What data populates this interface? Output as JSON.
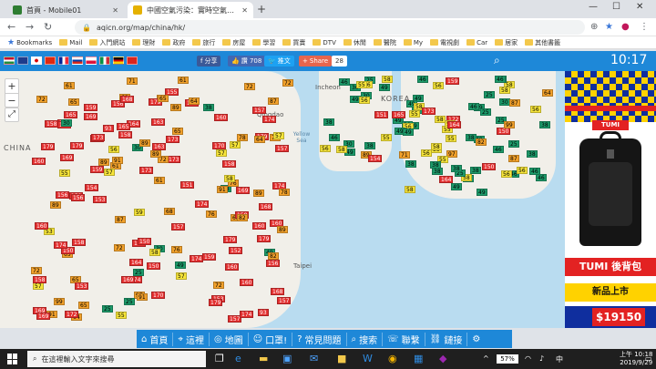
{
  "tabs": [
    {
      "title": "首頁 - Mobile01",
      "favicon_color": "#2e7d32"
    },
    {
      "title": "中國空氣污染：實時空氣質量指數",
      "favicon_color": "#e5b100"
    }
  ],
  "address": {
    "url": "aqicn.org/map/china/hk/"
  },
  "bookmarks": [
    {
      "label": "Bookmarks"
    },
    {
      "label": "Mail"
    },
    {
      "label": "入門網站"
    },
    {
      "label": "理財"
    },
    {
      "label": "政府"
    },
    {
      "label": "旅行"
    },
    {
      "label": "房屋"
    },
    {
      "label": "學習"
    },
    {
      "label": "買賣"
    },
    {
      "label": "DTV"
    },
    {
      "label": "休閒"
    },
    {
      "label": "醫院"
    },
    {
      "label": "My"
    },
    {
      "label": "電視劇"
    },
    {
      "label": "Car"
    },
    {
      "label": "居家"
    },
    {
      "label": "其他書籤"
    }
  ],
  "share": {
    "fb_label": "分享",
    "like_label": "讚 708",
    "tweet_label": "推文",
    "share_label": "Share",
    "share_count": "28"
  },
  "clock": "10:17",
  "map": {
    "label_china": "CHINA",
    "label_korea": "KOREA",
    "label_incheon": "Incheon",
    "label_qingdao": "Qingdao",
    "label_yellow_sea": "Yellow Sea",
    "label_taipei": "Taipei",
    "colors": {
      "hazard": "#e32f2f",
      "unhealthy": "#f2a12b",
      "moderate": "#f7e53a",
      "good": "#1d9a6a"
    },
    "stations": [
      {
        "v": "93",
        "c": "hazard"
      },
      {
        "v": "72",
        "c": "unhealthy"
      },
      {
        "v": "163",
        "c": "hazard"
      },
      {
        "v": "172",
        "c": "hazard"
      },
      {
        "v": "154",
        "c": "hazard"
      },
      {
        "v": "157",
        "c": "hazard"
      },
      {
        "v": "160",
        "c": "hazard"
      },
      {
        "v": "173",
        "c": "hazard"
      },
      {
        "v": "174",
        "c": "hazard"
      },
      {
        "v": "71",
        "c": "unhealthy"
      },
      {
        "v": "61",
        "c": "unhealthy"
      },
      {
        "v": "89",
        "c": "unhealthy"
      },
      {
        "v": "159",
        "c": "hazard"
      },
      {
        "v": "152",
        "c": "hazard"
      },
      {
        "v": "158",
        "c": "hazard"
      },
      {
        "v": "165",
        "c": "hazard"
      },
      {
        "v": "87",
        "c": "unhealthy"
      },
      {
        "v": "53",
        "c": "moderate"
      },
      {
        "v": "151",
        "c": "hazard"
      },
      {
        "v": "156",
        "c": "hazard"
      },
      {
        "v": "168",
        "c": "hazard"
      },
      {
        "v": "64",
        "c": "unhealthy"
      },
      {
        "v": "155",
        "c": "hazard"
      },
      {
        "v": "179",
        "c": "hazard"
      },
      {
        "v": "169",
        "c": "hazard"
      },
      {
        "v": "153",
        "c": "hazard"
      },
      {
        "v": "91",
        "c": "unhealthy"
      },
      {
        "v": "97",
        "c": "unhealthy"
      },
      {
        "v": "65",
        "c": "unhealthy"
      },
      {
        "v": "56",
        "c": "moderate"
      },
      {
        "v": "49",
        "c": "good"
      },
      {
        "v": "164",
        "c": "hazard"
      },
      {
        "v": "59",
        "c": "moderate"
      },
      {
        "v": "76",
        "c": "unhealthy"
      },
      {
        "v": "70",
        "c": "unhealthy"
      },
      {
        "v": "38",
        "c": "good"
      },
      {
        "v": "25",
        "c": "good"
      },
      {
        "v": "30",
        "c": "good"
      },
      {
        "v": "58",
        "c": "moderate"
      },
      {
        "v": "55",
        "c": "moderate"
      },
      {
        "v": "46",
        "c": "good"
      },
      {
        "v": "99",
        "c": "unhealthy"
      },
      {
        "v": "68",
        "c": "unhealthy"
      },
      {
        "v": "57",
        "c": "moderate"
      },
      {
        "v": "82",
        "c": "unhealthy"
      },
      {
        "v": "78",
        "c": "unhealthy"
      },
      {
        "v": "150",
        "c": "hazard"
      },
      {
        "v": "170",
        "c": "hazard"
      }
    ]
  },
  "ad": {
    "title": "TUMI 後背包",
    "subtitle": "新品上市",
    "price": "$19150",
    "logo": "TUMI"
  },
  "site_nav": [
    {
      "label": "首頁",
      "icon": "home-icon"
    },
    {
      "label": "這裡",
      "icon": "location-icon"
    },
    {
      "label": "地圖",
      "icon": "map-icon"
    },
    {
      "label": "口罩!",
      "icon": "mask-icon"
    },
    {
      "label": "常見問題",
      "icon": "faq-icon"
    },
    {
      "label": "搜索",
      "icon": "search-icon"
    },
    {
      "label": "聯繫",
      "icon": "contact-icon"
    },
    {
      "label": "鏈接",
      "icon": "link-icon"
    }
  ],
  "taskbar": {
    "search_placeholder": "在這裡輸入文字來搜尋",
    "battery": "57%",
    "time": "上午 10:18",
    "date": "2019/9/29"
  }
}
